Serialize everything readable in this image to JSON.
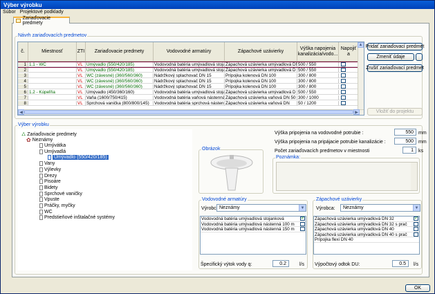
{
  "window": {
    "title": "Výber výrobku"
  },
  "menu": [
    "Súbor",
    "Projektové podklady"
  ],
  "tab": {
    "label": "Zariaďovacie predmety"
  },
  "top_group": {
    "legend": "Návrh zariaďovacích predmetov"
  },
  "table": {
    "columns": [
      "č.",
      "Miestnosť",
      "ZTI",
      "Zariaďovacie predmety",
      "Vodovodné armatúry",
      "Zápachové uzávierky",
      "Výška napojenia kanalizácia/vodo...",
      "Napojiť a"
    ],
    "rows": [
      {
        "n": "1",
        "room": "1.1 - WC",
        "zti": "VL",
        "item": "Umývadlo (550/420/185)",
        "arm": "Vodovodná batéria umývadlová stojan",
        "trap": "Zápachová uzávierka umývadlová DN",
        "h": "500 / 550"
      },
      {
        "n": "2",
        "room": "",
        "zti": "VL",
        "item": "Umývadlo (550/420/185)",
        "arm": "Vodovodná batéria umývadlová stojan",
        "trap": "Zápachová uzávierka umývadlová D",
        "h": "500 / 550"
      },
      {
        "n": "3",
        "room": "",
        "zti": "VL",
        "item": "WC (závesné) (360/560/360)",
        "arm": "Nádržkový splachovač DN 15",
        "trap": "Prípojka kolenová DN 100",
        "h": "300 / 800"
      },
      {
        "n": "4",
        "room": "",
        "zti": "VL",
        "item": "WC (závesné) (360/560/360)",
        "arm": "Nádržkový splachovač DN 15",
        "trap": "Prípojka kolenová DN 100",
        "h": "300 / 800"
      },
      {
        "n": "5",
        "room": "",
        "zti": "VL",
        "item": "WC (závesné) (360/560/360)",
        "arm": "Nádržkový splachovač DN 15",
        "trap": "Prípojka kolenová DN 100",
        "h": "300 / 800"
      },
      {
        "n": "6",
        "room": "1.2 - Kúpeľňa",
        "zti": "VL",
        "item": "Umývadlo (450/360/160)",
        "arm": "Vodovodná batéria umývadlová stojan",
        "trap": "Zápachová uzávierka umývadlová D",
        "h": "500 / 550"
      },
      {
        "n": "7",
        "room": "",
        "zti": "VL",
        "item": "Vaňa (1600/750/415)",
        "arm": "Vodovodná batéria vaňová nástenná",
        "trap": "Zápachová uzávierka vaňová DN 50",
        "h": "300 / 1000"
      },
      {
        "n": "8",
        "room": "",
        "zti": "VL",
        "item": "Sprchová vanička (800/800/145)",
        "arm": "Vodovodná batéria sprchová nástenná",
        "trap": "Zápachová uzávierka vaňová DN",
        "h": "50 / 1200"
      }
    ]
  },
  "buttons": {
    "add": "Pridať zariaďovací predmet",
    "change": "Zmeniť údaje",
    "cancel": "Zrušiť zariaďovací predmet",
    "cut": "Vložiť do projektu",
    "ok": "OK"
  },
  "selection_group": {
    "legend": "Výber výrobku"
  },
  "tree": {
    "root": "Zariaďovacie predmety",
    "unknown": "Neznámy",
    "items": [
      "Umývátka",
      "Umývadlá",
      "Umývadlo (550/420/185)",
      "Vany",
      "Výlevky",
      "Drezy",
      "Pisoáre",
      "Bidety",
      "Sprchové vaničky",
      "Vpuste",
      "Práčky, myčky",
      "WC",
      "Predstieňové inštalačné systémy"
    ]
  },
  "picture": {
    "legend": "Obrázok"
  },
  "fields": {
    "water_height_label": "Výška pripojenia na vodovodné potrubie :",
    "water_height_value": "550",
    "drain_height_label": "Výška pripojenia na pripájacie potrubie kanalizácie :",
    "drain_height_value": "500",
    "count_label": "Počet zariaďovacích predmetov v miestnosti",
    "count_value": "1",
    "unit_mm": "mm",
    "unit_ks": "ks",
    "note_label": "Poznámka:"
  },
  "armatures": {
    "legend": "Vodovodné armatúry",
    "maker_label": "Výrobca:",
    "maker_value": "Neznámy",
    "items": [
      {
        "label": "Vodovodná batéria umývadlová stojanková",
        "checked": true
      },
      {
        "label": "Vodovodná batéria umývadlová nástenná 100 m",
        "checked": false
      },
      {
        "label": "Vodovodná batéria umývadlová nástenná 150 m",
        "checked": false
      }
    ],
    "flow_label": "Špecifický výtok vody q:",
    "flow_value": "0.2",
    "flow_unit": "l/s"
  },
  "traps": {
    "legend": "Zápachové uzávierky",
    "maker_label": "Výrobca:",
    "maker_value": "Neznámy",
    "items": [
      {
        "label": "Zápachová uzávierka umývadlová DN 32",
        "checked": true
      },
      {
        "label": "Zápachová uzávierka umývadlová DN 32 s prač",
        "checked": false
      },
      {
        "label": "Zápachová uzávierka umývadlová DN 40",
        "checked": false
      },
      {
        "label": "Zápachová uzávierka umývadlová DN 40 s prač",
        "checked": false
      },
      {
        "label": "Prípojka flexi DN 40",
        "checked": false
      }
    ],
    "flow_label": "Výpočtový odtok DU:",
    "flow_value": "0.5",
    "flow_unit": "l/s"
  }
}
